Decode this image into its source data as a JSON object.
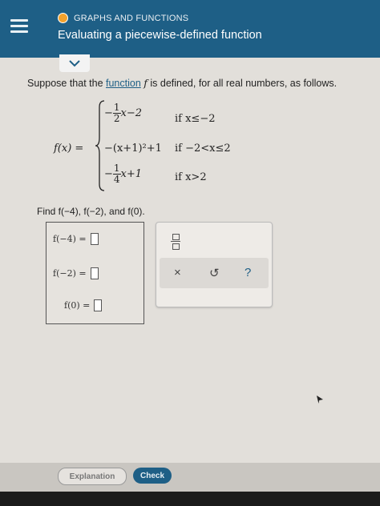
{
  "header": {
    "topic": "GRAPHS AND FUNCTIONS",
    "title": "Evaluating a piecewise-defined function"
  },
  "prompt": {
    "before": "Suppose that the ",
    "link": "function",
    "mid": " ",
    "fname": "f",
    "after": " is defined, for all real numbers, as follows."
  },
  "definition": {
    "label": "f(x) =",
    "pieces": [
      {
        "coef_sign": "−",
        "num": "1",
        "den": "2",
        "rest": "x−2",
        "cond": "if x≤−2"
      },
      {
        "expr": "−(x+1)²+1",
        "cond": "if −2<x≤2"
      },
      {
        "coef_sign": "−",
        "num": "1",
        "den": "4",
        "rest": "x+1",
        "cond": "if x>2"
      }
    ]
  },
  "find": {
    "text": "Find f(−4), f(−2), and f(0)."
  },
  "answers": [
    {
      "label": "f(−4) =",
      "value": ""
    },
    {
      "label": "f(−2) =",
      "value": ""
    },
    {
      "label": "f(0) =",
      "value": ""
    }
  ],
  "keypad": {
    "fraction_icon": "fraction-template-icon",
    "clear": "×",
    "undo": "↺",
    "help": "?"
  },
  "buttons": {
    "explanation": "Explanation",
    "check": "Check"
  },
  "colors": {
    "header_bg": "#1e5f86",
    "topic_dot": "#f2a22d",
    "link": "#1e5f86"
  }
}
